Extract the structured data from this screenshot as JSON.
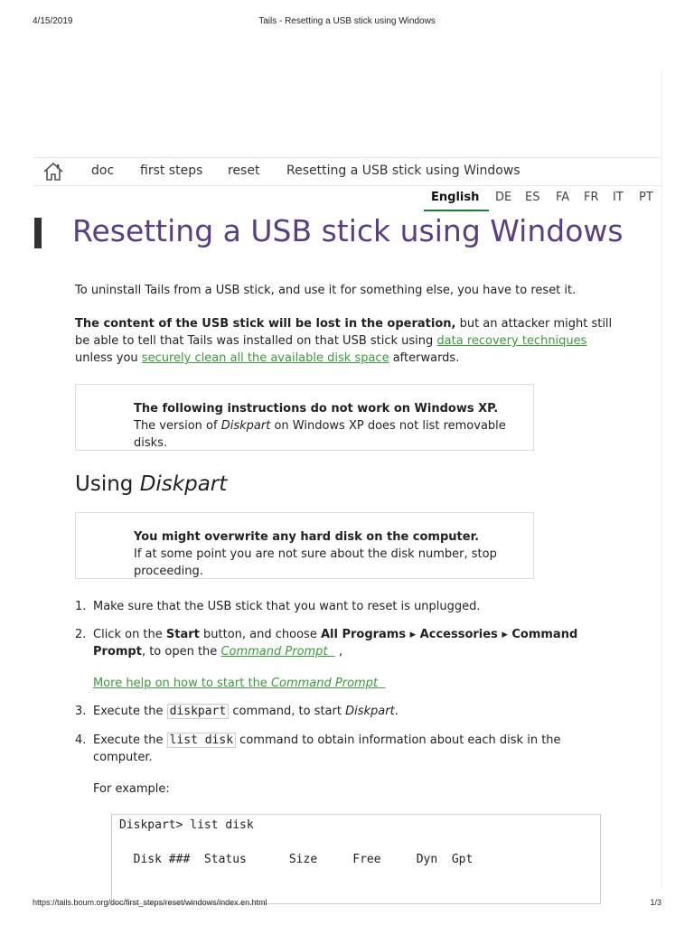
{
  "print_header": {
    "date": "4/15/2019",
    "title": "Tails - Resetting a USB stick using Windows"
  },
  "print_footer": {
    "url": "https://tails.boum.org/doc/first_steps/reset/windows/index.en.html",
    "page": "1/3"
  },
  "breadcrumb": {
    "home_icon": "home-icon",
    "items": [
      "doc",
      "first steps",
      "reset",
      "Resetting a USB stick using Windows"
    ]
  },
  "languages": {
    "current": "English",
    "others": [
      "DE",
      "ES",
      "FA",
      "FR",
      "IT",
      "PT"
    ],
    "accent": "#1e7a34"
  },
  "page_title": "Resetting a USB stick using Windows",
  "title_color": "#5a3e85",
  "link_color": "#3a9a3a",
  "intro": "To uninstall Tails from a USB stick, and use it for something else, you have to reset it.",
  "warning_para": {
    "bold": "The content of the USB stick will be lost in the operation,",
    "text1": " but an attacker might still be able to tell that Tails was installed on that USB stick using ",
    "link1": "data recovery techniques",
    "text2": " unless you ",
    "link2": "securely clean all the available disk space",
    "text3": " afterwards."
  },
  "note_xp": {
    "bold": "The following instructions do not work on Windows XP.",
    "text1": "The version of ",
    "em": "Diskpart",
    "text2": " on Windows XP does not list removable disks."
  },
  "section_heading": {
    "prefix": "Using ",
    "em": "Diskpart"
  },
  "note_overwrite": {
    "bold": "You might overwrite any hard disk on the computer.",
    "text": "If at some point you are not sure about the disk number, stop proceeding."
  },
  "steps": {
    "s1": {
      "num": "1.",
      "text": "Make sure that the USB stick that you want to reset is unplugged."
    },
    "s2": {
      "num": "2.",
      "t1": "Click on the ",
      "b1": "Start",
      "t2": " button, and choose ",
      "b2": "All Programs ▸ Accessories ▸ Command Prompt",
      "t3": ", to open the ",
      "link": "Command Prompt",
      "t4": " ,",
      "help_prefix": "More help on how to start the ",
      "help_em": "Command Prompt"
    },
    "s3": {
      "num": "3.",
      "t1": "Execute the ",
      "code": "diskpart",
      "t2": " command, to start ",
      "em": "Diskpart",
      "t3": "."
    },
    "s4": {
      "num": "4.",
      "t1": "Execute the ",
      "code": "list disk",
      "t2": " command to obtain information about each disk in the computer.",
      "example": "For example:"
    }
  },
  "code_sample": {
    "line1": "Diskpart> list disk",
    "line2": "  Disk ###  Status      Size     Free     Dyn  Gpt"
  }
}
